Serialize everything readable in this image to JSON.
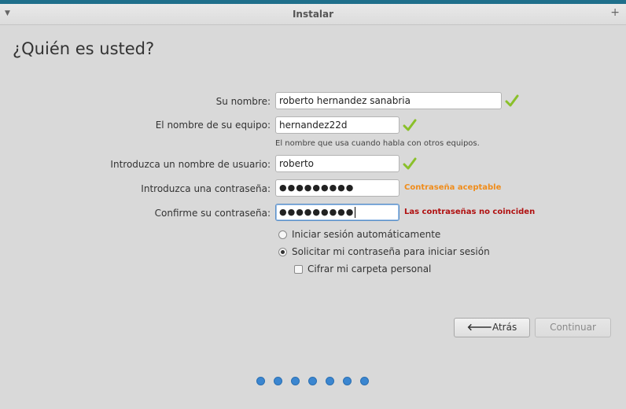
{
  "window": {
    "title": "Instalar",
    "menu_icon": "chevron-down-icon",
    "plus_icon": "plus-icon"
  },
  "heading": "¿Quién es usted?",
  "form": {
    "name": {
      "label": "Su nombre:",
      "value": "roberto hernandez sanabria",
      "valid": true
    },
    "computer": {
      "label": "El nombre de su equipo:",
      "value": "hernandez22d",
      "valid": true,
      "hint": "El nombre que usa cuando habla con otros equipos."
    },
    "username": {
      "label": "Introduzca un nombre de usuario:",
      "value": "roberto",
      "valid": true
    },
    "password": {
      "label": "Introduzca una contraseña:",
      "value": "●●●●●●●●●",
      "status": "Contraseña aceptable"
    },
    "confirm": {
      "label": "Confirme su contraseña:",
      "value": "●●●●●●●●●",
      "status": "Las contraseñas no coinciden"
    }
  },
  "options": {
    "auto_login": {
      "label": "Iniciar sesión automáticamente",
      "selected": false
    },
    "require_password": {
      "label": "Solicitar mi contraseña para iniciar sesión",
      "selected": true
    },
    "encrypt_home": {
      "label": "Cifrar mi carpeta personal",
      "checked": false
    }
  },
  "buttons": {
    "back": "Atrás",
    "continue": "Continuar"
  },
  "colors": {
    "accent": "#3b86d0",
    "ok_status": "#f08c1a",
    "error_status": "#b01010",
    "check": "#8ac02a"
  },
  "progress": {
    "total_steps": 7
  }
}
